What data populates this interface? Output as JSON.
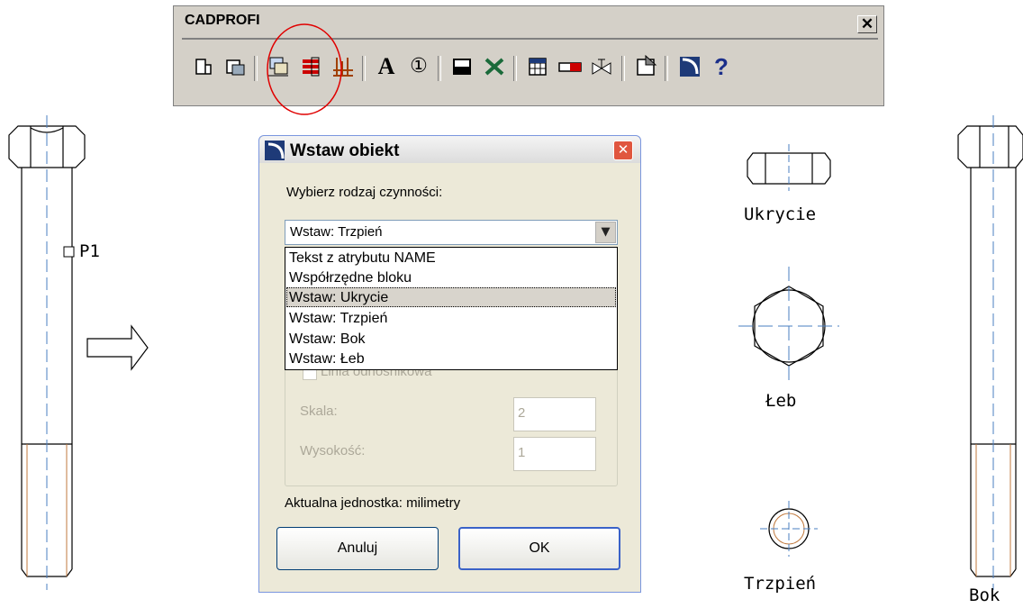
{
  "toolbar": {
    "title": "CADPROFI",
    "close_symbol": "✕",
    "icons": [
      "page-icon",
      "table-import-icon",
      "insert-object-icon",
      "layer-list-icon",
      "bar-chart-icon",
      "text-a-icon",
      "numbered-circle-icon",
      "rectangle-icon",
      "scissors-icon",
      "table-icon",
      "eraser-icon",
      "valve-icon",
      "properties-icon",
      "cadprofi-logo-icon",
      "help-icon"
    ],
    "icon_glyphs": {
      "numbered-circle-icon": "①",
      "help-icon": "?",
      "text-a-icon": "A"
    },
    "highlight_color": "#e00000"
  },
  "dialog": {
    "title": "Wstaw obiekt",
    "action_label": "Wybierz rodzaj czynności:",
    "selected_value": "Wstaw: Trzpień",
    "options": [
      "Tekst z atrybutu NAME",
      "Współrzędne bloku",
      "Wstaw: Ukrycie",
      "Wstaw: Trzpień",
      "Wstaw: Bok",
      "Wstaw: Łeb"
    ],
    "highlighted_option": "Wstaw: Ukrycie",
    "leader_checkbox_label": "Linia odnośnikowa",
    "scale_label": "Skala:",
    "scale_value": "2",
    "height_label": "Wysokość:",
    "height_value": "1",
    "unit_text": "Aktualna jednostka: milimetry",
    "cancel_label": "Anuluj",
    "ok_label": "OK"
  },
  "drawing": {
    "point_label": "P1",
    "views": [
      "Ukrycie",
      "Łeb",
      "Trzpień",
      "Bok"
    ],
    "line_color": "#000000",
    "centerline_color": "#4a7fc0",
    "thread_color": "#c0783c"
  }
}
